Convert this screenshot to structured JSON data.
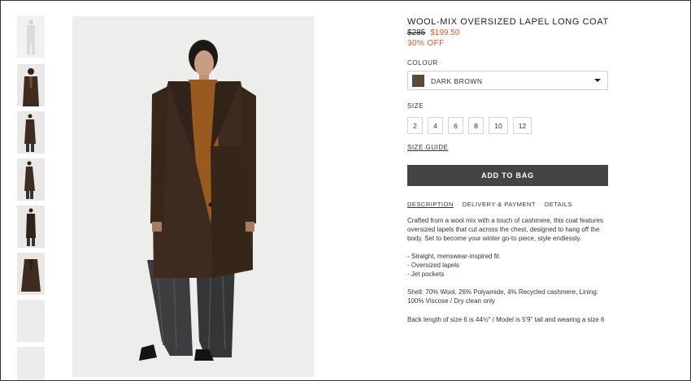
{
  "product": {
    "title": "WOOL-MIX OVERSIZED LAPEL LONG COAT",
    "old_price": "$285",
    "new_price": "$199.50",
    "discount": "30% OFF"
  },
  "colour": {
    "label": "COLOUR",
    "selected": "DARK BROWN",
    "swatch": "#5a4a3a"
  },
  "size": {
    "label": "SIZE",
    "options": [
      "2",
      "4",
      "6",
      "8",
      "10",
      "12"
    ],
    "guide": "SIZE GUIDE"
  },
  "add_to_bag": "ADD TO BAG",
  "tabs": [
    "DESCRIPTION",
    "DELIVERY & PAYMENT",
    "DETAILS"
  ],
  "tab_separator": "·",
  "description": {
    "text": "Crafted from a wool mix with a touch of cashmere, this coat features oversized lapels that cut across the chest, designed to hang off the body. Set to become your winter go-to piece, style endlessly.",
    "bullets": [
      "- Straight, menswear-inspired fit",
      "- Oversized lapels",
      "- Jet pockets"
    ],
    "composition": "Shell: 70% Wool, 26% Polyamide, 4% Recycled cashmere, Lining: 100% Viscose / Dry clean only",
    "fit": "Back length of size 6 is 44½\"  / Model is 5'9\" tall and wearing a size 6"
  },
  "colors": {
    "accent": "#e0562a",
    "button": "#444444",
    "coat": "#4a3526"
  }
}
